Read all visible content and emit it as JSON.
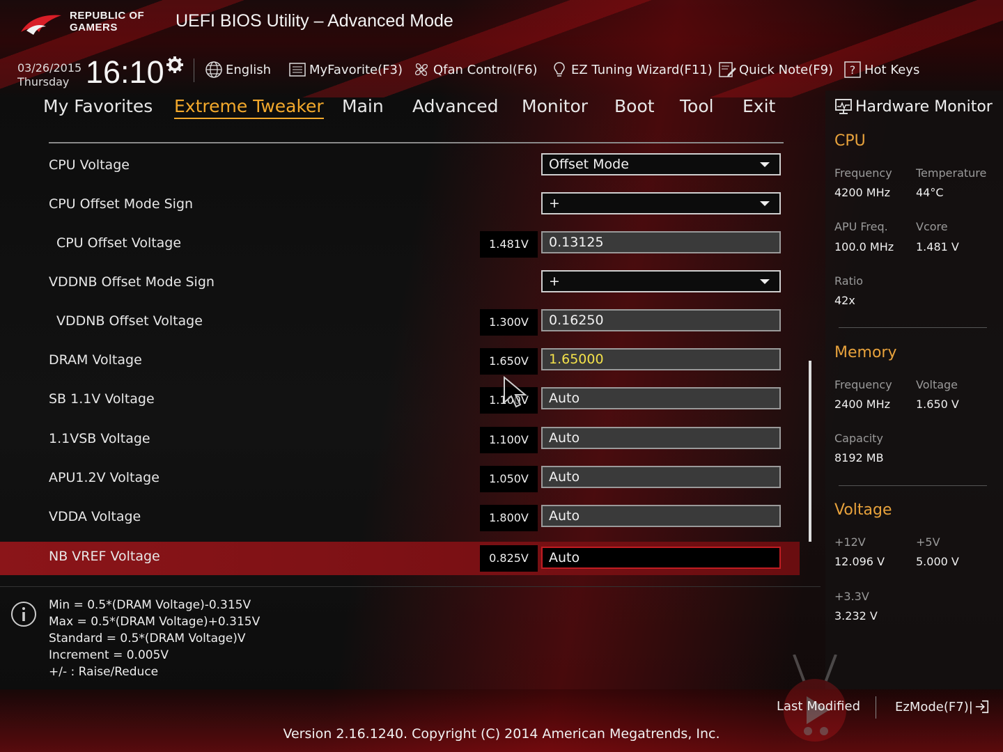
{
  "header": {
    "brand_line1": "REPUBLIC OF",
    "brand_line2": "GAMERS",
    "title": "UEFI BIOS Utility – Advanced Mode",
    "date": "03/26/2015",
    "weekday": "Thursday",
    "time": "16:10",
    "toolbar": {
      "language": "English",
      "myfavorite": "MyFavorite(F3)",
      "qfan": "Qfan Control(F6)",
      "ez_tuning": "EZ Tuning Wizard(F11)",
      "quick_note": "Quick Note(F9)",
      "hot_keys": "Hot Keys"
    }
  },
  "nav": {
    "active": "Extreme Tweaker",
    "tabs": [
      "My Favorites",
      "Extreme Tweaker",
      "Main",
      "Advanced",
      "Monitor",
      "Boot",
      "Tool",
      "Exit"
    ]
  },
  "settings": [
    {
      "label": "CPU Voltage",
      "readout": "",
      "value": "Offset Mode",
      "type": "dropdown"
    },
    {
      "label": "CPU Offset Mode Sign",
      "readout": "",
      "value": "+",
      "type": "dropdown"
    },
    {
      "label": "CPU Offset Voltage",
      "readout": "1.481V",
      "value": "0.13125",
      "type": "text"
    },
    {
      "label": "VDDNB Offset Mode Sign",
      "readout": "",
      "value": "+",
      "type": "dropdown"
    },
    {
      "label": "VDDNB Offset Voltage",
      "readout": "1.300V",
      "value": "0.16250",
      "type": "text"
    },
    {
      "label": "DRAM Voltage",
      "readout": "1.650V",
      "value": "1.65000",
      "type": "text"
    },
    {
      "label": "SB 1.1V Voltage",
      "readout": "1.100V",
      "value": "Auto",
      "type": "text"
    },
    {
      "label": "1.1VSB Voltage",
      "readout": "1.100V",
      "value": "Auto",
      "type": "text"
    },
    {
      "label": "APU1.2V Voltage",
      "readout": "1.050V",
      "value": "Auto",
      "type": "text"
    },
    {
      "label": "VDDA Voltage",
      "readout": "1.800V",
      "value": "Auto",
      "type": "text"
    },
    {
      "label": "NB VREF Voltage",
      "readout": "0.825V",
      "value": "Auto",
      "type": "text"
    }
  ],
  "info": {
    "lines": [
      "Min = 0.5*(DRAM Voltage)-0.315V",
      "Max = 0.5*(DRAM Voltage)+0.315V",
      "Standard = 0.5*(DRAM Voltage)V",
      "Increment = 0.005V",
      "+/- : Raise/Reduce"
    ]
  },
  "hardware_monitor": {
    "title": "Hardware Monitor",
    "cpu": {
      "heading": "CPU",
      "frequency_label": "Frequency",
      "frequency": "4200 MHz",
      "temperature_label": "Temperature",
      "temperature": "44°C",
      "apu_freq_label": "APU Freq.",
      "apu_freq": "100.0 MHz",
      "vcore_label": "Vcore",
      "vcore": "1.481 V",
      "ratio_label": "Ratio",
      "ratio": "42x"
    },
    "memory": {
      "heading": "Memory",
      "frequency_label": "Frequency",
      "frequency": "2400 MHz",
      "voltage_label": "Voltage",
      "voltage": "1.650 V",
      "capacity_label": "Capacity",
      "capacity": "8192 MB"
    },
    "voltage": {
      "heading": "Voltage",
      "v12_label": "+12V",
      "v12": "12.096 V",
      "v5_label": "+5V",
      "v5": "5.000 V",
      "v33_label": "+3.3V",
      "v33": "3.232 V"
    }
  },
  "footer": {
    "last_modified": "Last Modified",
    "ezmode": "EzMode(F7)|",
    "version": "Version 2.16.1240. Copyright (C) 2014 American Megatrends, Inc."
  },
  "colors": {
    "accent": "#f3a92c",
    "highlight_value": "#f4e24a",
    "selected_row": "#8b1519",
    "brand_red": "#c01c22"
  }
}
